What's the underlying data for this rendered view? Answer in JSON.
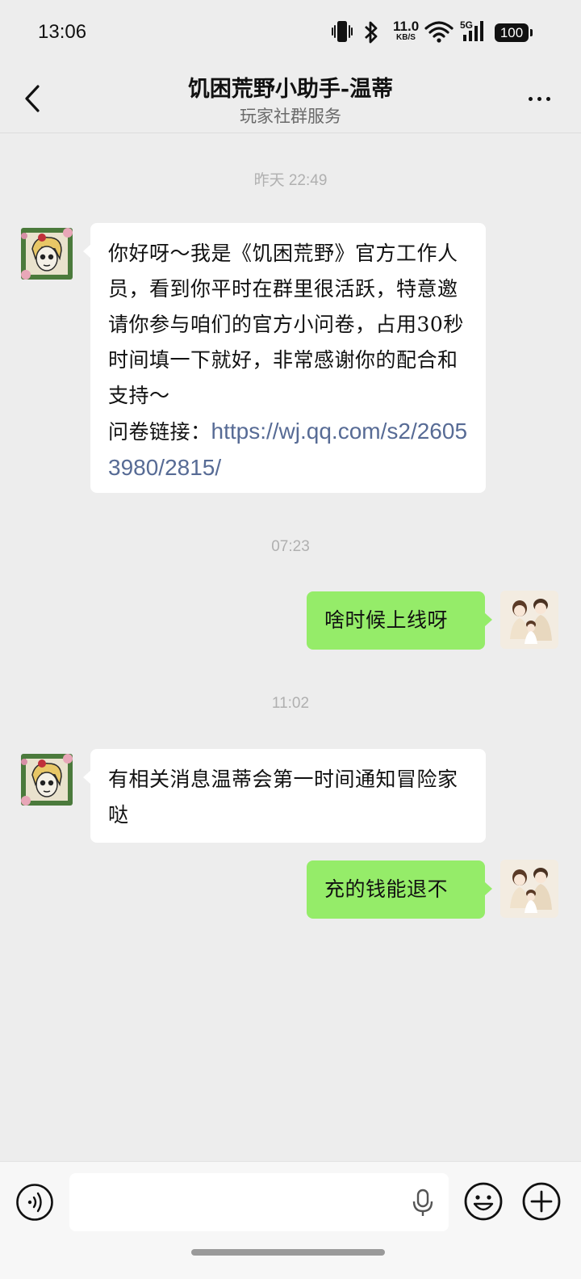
{
  "status_bar": {
    "time": "13:06",
    "net_speed_value": "11.0",
    "net_speed_unit": "KB/S",
    "network_type": "5G",
    "battery": "100"
  },
  "header": {
    "title": "饥困荒野小助手-温蒂",
    "subtitle": "玩家社群服务"
  },
  "messages": {
    "ts1": "昨天 22:49",
    "msg1_text": "你好呀～我是《饥困荒野》官方工作人员，看到你平时在群里很活跃，特意邀请你参与咱们的官方小问卷，占用30秒时间填一下就好，非常感谢你的配合和支持～",
    "msg1_link_label": "问卷链接：",
    "msg1_link": "https://wj.qq.com/s2/26053980/2815/",
    "ts2": "07:23",
    "msg2_text": "啥时候上线呀",
    "ts3": "11:02",
    "msg3_text": "有相关消息温蒂会第一时间通知冒险家哒",
    "msg4_text": "充的钱能退不"
  },
  "input_bar": {
    "placeholder": ""
  },
  "colors": {
    "background": "#ededed",
    "sent_bubble": "#95ec69",
    "received_bubble": "#ffffff",
    "link": "#576b95"
  },
  "icons": [
    "back-icon",
    "more-icon",
    "voice-icon",
    "mic-icon",
    "emoji-icon",
    "add-icon",
    "vibrate-icon",
    "bluetooth-icon",
    "wifi-icon",
    "signal-icon",
    "battery-icon"
  ]
}
